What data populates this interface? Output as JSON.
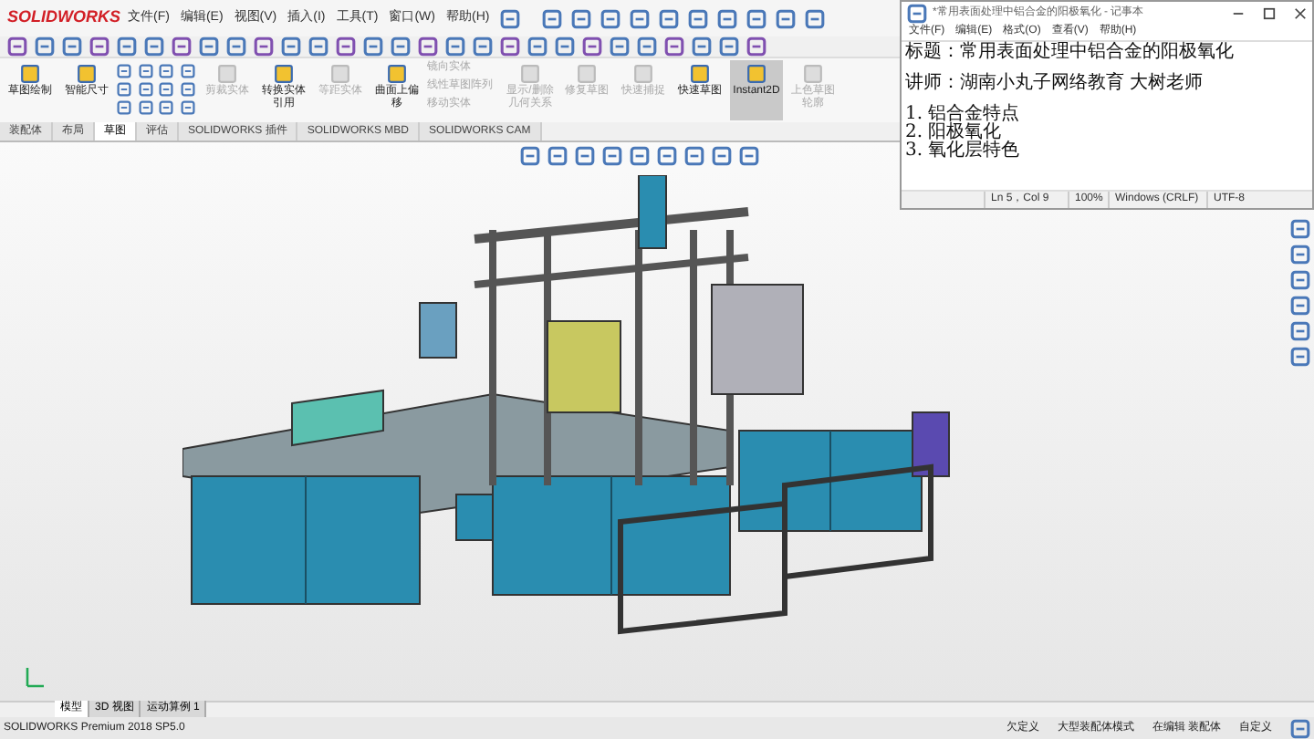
{
  "app": {
    "logo": "SOLIDWORKS",
    "menu": [
      "文件(F)",
      "编辑(E)",
      "视图(V)",
      "插入(I)",
      "工具(T)",
      "窗口(W)",
      "帮助(H)"
    ]
  },
  "ribbon": {
    "buttons": [
      {
        "label": "草图绘制",
        "disabled": false,
        "selected": false
      },
      {
        "label": "智能尺寸",
        "disabled": false,
        "selected": false
      },
      {
        "label": "剪裁实体",
        "disabled": true,
        "selected": false
      },
      {
        "label": "转换实体引用",
        "disabled": false,
        "selected": false
      },
      {
        "label": "等距实体",
        "disabled": true,
        "selected": false
      },
      {
        "label": "曲面上偏移",
        "disabled": false,
        "selected": false
      }
    ],
    "list": [
      {
        "label": "镜向实体",
        "disabled": true
      },
      {
        "label": "线性草图阵列",
        "disabled": true
      },
      {
        "label": "移动实体",
        "disabled": true
      }
    ],
    "buttons_2": [
      {
        "label": "显示/删除几何关系",
        "disabled": true,
        "selected": false
      },
      {
        "label": "修复草图",
        "disabled": true,
        "selected": false
      },
      {
        "label": "快速捕捉",
        "disabled": true,
        "selected": false
      },
      {
        "label": "快速草图",
        "disabled": false,
        "selected": false
      },
      {
        "label": "Instant2D",
        "disabled": false,
        "selected": true
      },
      {
        "label": "上色草图轮廓",
        "disabled": true,
        "selected": false
      }
    ]
  },
  "tabs": [
    {
      "label": "装配体",
      "selected": false
    },
    {
      "label": "布局",
      "selected": false
    },
    {
      "label": "草图",
      "selected": true
    },
    {
      "label": "评估",
      "selected": false
    },
    {
      "label": "SOLIDWORKS 插件",
      "selected": false
    },
    {
      "label": "SOLIDWORKS MBD",
      "selected": false
    },
    {
      "label": "SOLIDWORKS CAM",
      "selected": false
    }
  ],
  "model_tabs": [
    {
      "label": "模型",
      "selected": true
    },
    {
      "label": "3D 视图",
      "selected": false
    },
    {
      "label": "运动算例 1",
      "selected": false
    }
  ],
  "status_bar": {
    "product": "SOLIDWORKS Premium 2018 SP5.0",
    "items": [
      "欠定义",
      "大型装配体模式",
      "在编辑 装配体",
      "自定义"
    ]
  },
  "notepad": {
    "title": "*常用表面处理中铝合金的阳极氧化 - 记事本",
    "menu": [
      "文件(F)",
      "编辑(E)",
      "格式(O)",
      "查看(V)",
      "帮助(H)"
    ],
    "paragraphs": [
      [
        "标题：常用表面处理中铝合金的阳极氧化"
      ],
      [
        "讲师：湖南小丸子网络教育    大树老师"
      ],
      [
        "1. 铝合金特点",
        "2. 阳极氧化",
        "3. 氧化层特色"
      ]
    ],
    "status": [
      "Ln 5，Col 9",
      "100%",
      "Windows (CRLF)",
      "UTF-8"
    ]
  }
}
